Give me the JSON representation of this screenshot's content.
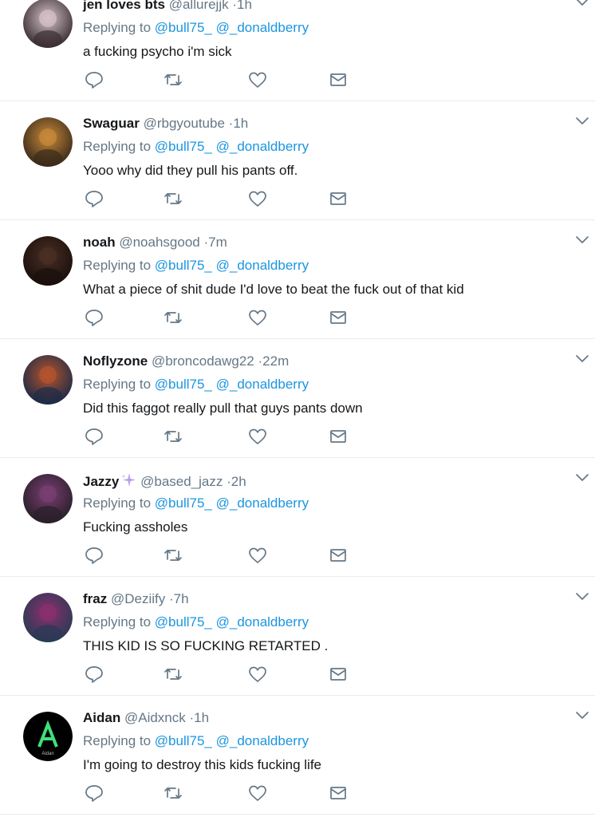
{
  "tweets": [
    {
      "name": "jen loves bts",
      "handle": "@allurejjk",
      "time": "·1h",
      "replying_prefix": "Replying to",
      "mention1": "@bull75_",
      "mention2": "@_donaldberry",
      "text": "a fucking psycho i'm sick",
      "avatar_colors": [
        "#d6c2c8",
        "#3a2f33"
      ]
    },
    {
      "name": "Swaguar",
      "handle": "@rbgyoutube",
      "time": "·1h",
      "replying_prefix": "Replying to",
      "mention1": "@bull75_",
      "mention2": "@_donaldberry",
      "text": "Yooo why did they pull his pants off.",
      "avatar_colors": [
        "#c98a3b",
        "#3b2b1a"
      ]
    },
    {
      "name": "noah",
      "handle": "@noahsgood",
      "time": "·7m",
      "replying_prefix": "Replying to",
      "mention1": "@bull75_",
      "mention2": "@_donaldberry",
      "text": "What a piece of shit dude I'd love to beat the fuck out of that kid",
      "avatar_colors": [
        "#4a2f24",
        "#1a0f0c"
      ]
    },
    {
      "name": "Noflyzone",
      "handle": "@broncodawg22",
      "time": "·22m",
      "replying_prefix": "Replying to",
      "mention1": "@bull75_",
      "mention2": "@_donaldberry",
      "text": "Did this faggot really pull that guys pants down",
      "avatar_colors": [
        "#b5542c",
        "#1f2b47"
      ]
    },
    {
      "name": "Jazzy",
      "handle": "@based_jazz",
      "time": "·2h",
      "replying_prefix": "Replying to",
      "mention1": "@bull75_",
      "mention2": "@_donaldberry",
      "text": "Fucking assholes",
      "avatar_colors": [
        "#7a3f74",
        "#2a1f2a"
      ]
    },
    {
      "name": "fraz",
      "handle": "@Deziify",
      "time": "·7h",
      "replying_prefix": "Replying to",
      "mention1": "@bull75_",
      "mention2": "@_donaldberry",
      "text": "THIS KID IS SO FUCKING RETARTED .",
      "avatar_colors": [
        "#8c2f6f",
        "#2a3a55"
      ]
    },
    {
      "name": "Aidan",
      "handle": "@Aidxnck",
      "time": "·1h",
      "replying_prefix": "Replying to",
      "mention1": "@bull75_",
      "mention2": "@_donaldberry",
      "text": "I'm going to destroy this kids fucking life",
      "avatar_colors": [
        "#000000",
        "#2ecc71"
      ]
    }
  ],
  "icons": [
    "reply-icon",
    "retweet-icon",
    "like-icon",
    "direct-message-icon",
    "chevron-down-icon",
    "sparkle-icon"
  ],
  "colors": {
    "link": "#1b95e0",
    "secondary": "#657786",
    "divider": "#e6ecf0"
  }
}
